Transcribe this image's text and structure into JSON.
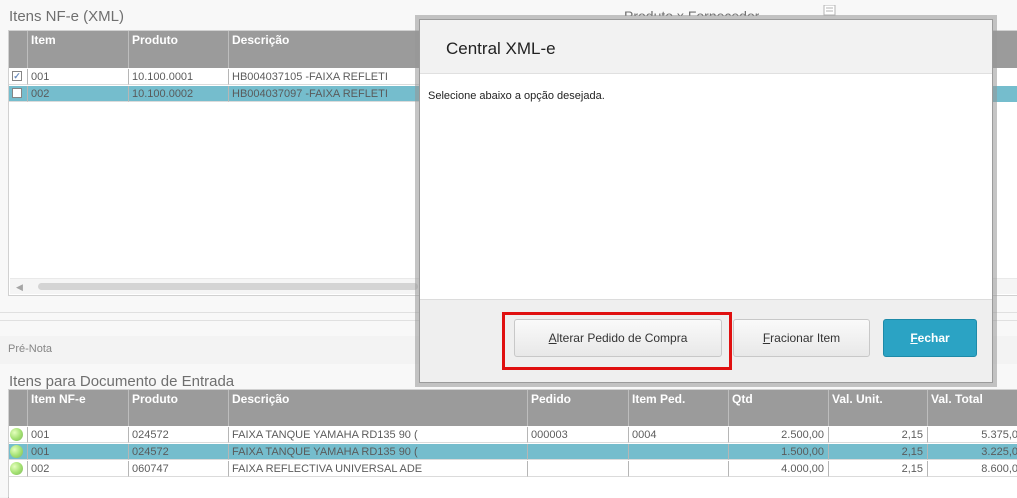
{
  "top_section": {
    "title": "Itens NF-e (XML)",
    "right_label": "Produto x Fornecedor",
    "columns": [
      "Item",
      "Produto",
      "Descrição"
    ],
    "rows": [
      {
        "checked": true,
        "item": "001",
        "produto": "10.100.0001",
        "descricao": "HB004037105 -FAIXA REFLETI",
        "selected": false
      },
      {
        "checked": false,
        "item": "002",
        "produto": "10.100.0002",
        "descricao": "HB004037097 -FAIXA REFLETI",
        "selected": true
      }
    ]
  },
  "pre_nota": {
    "label": "Pré-Nota"
  },
  "bottom_section": {
    "title": "Itens para Documento de Entrada",
    "columns": [
      "Item NF-e",
      "Produto",
      "Descrição",
      "Pedido",
      "Item Ped.",
      "Qtd",
      "Val. Unit.",
      "Val. Total"
    ],
    "rows": [
      {
        "item": "001",
        "produto": "024572",
        "descricao": "FAIXA TANQUE YAMAHA RD135 90 (",
        "pedido": "000003",
        "item_ped": "0004",
        "qtd": "2.500,00",
        "val_unit": "2,15",
        "val_total": "5.375,0",
        "selected": false
      },
      {
        "item": "001",
        "produto": "024572",
        "descricao": "FAIXA TANQUE YAMAHA RD135 90 (",
        "pedido": "",
        "item_ped": "",
        "qtd": "1.500,00",
        "val_unit": "2,15",
        "val_total": "3.225,0",
        "selected": true
      },
      {
        "item": "002",
        "produto": "060747",
        "descricao": "FAIXA REFLECTIVA UNIVERSAL ADE",
        "pedido": "",
        "item_ped": "",
        "qtd": "4.000,00",
        "val_unit": "2,15",
        "val_total": "8.600,0",
        "selected": false
      }
    ]
  },
  "modal": {
    "title": "Central XML-e",
    "message": "Selecione abaixo a opção desejada.",
    "buttons": {
      "alterar": {
        "first": "A",
        "rest": "lterar Pedido de Compra"
      },
      "fracionar": {
        "first": "F",
        "rest": "racionar Item"
      },
      "fechar": {
        "first": "F",
        "rest": "echar"
      }
    }
  },
  "colors": {
    "selected_row": "#2b9ab3",
    "grid_header": "#666666",
    "primary_button": "#2ba3c4",
    "highlight_box": "#e01010"
  },
  "icons": {
    "checkbox": "checkbox-icon",
    "status": "green-led-icon",
    "document": "document-icon",
    "scroll_left": "arrow-left-icon"
  }
}
